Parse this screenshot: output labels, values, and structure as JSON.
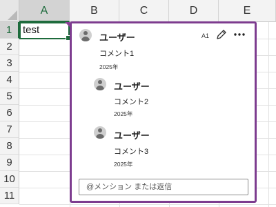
{
  "sheet": {
    "columns": [
      "A",
      "B",
      "C",
      "D",
      "E"
    ],
    "rows": [
      "1",
      "2",
      "3",
      "4",
      "5",
      "6",
      "7",
      "8",
      "9",
      "10",
      "11"
    ],
    "selected_cell_value": "test"
  },
  "comment_thread": {
    "cell_ref": "A1",
    "comments": [
      {
        "user": "ユーザー",
        "text": "コメント1",
        "date": "2025年"
      },
      {
        "user": "ユーザー",
        "text": "コメント2",
        "date": "2025年"
      },
      {
        "user": "ユーザー",
        "text": "コメント3",
        "date": "2025年"
      }
    ],
    "reply_placeholder": "@メンション または返信"
  },
  "colors": {
    "selection": "#1e6b3c",
    "comment_border": "#7d3c8f"
  },
  "icons": [
    "user-avatar-icon",
    "edit-pencil-icon",
    "more-options-icon"
  ]
}
